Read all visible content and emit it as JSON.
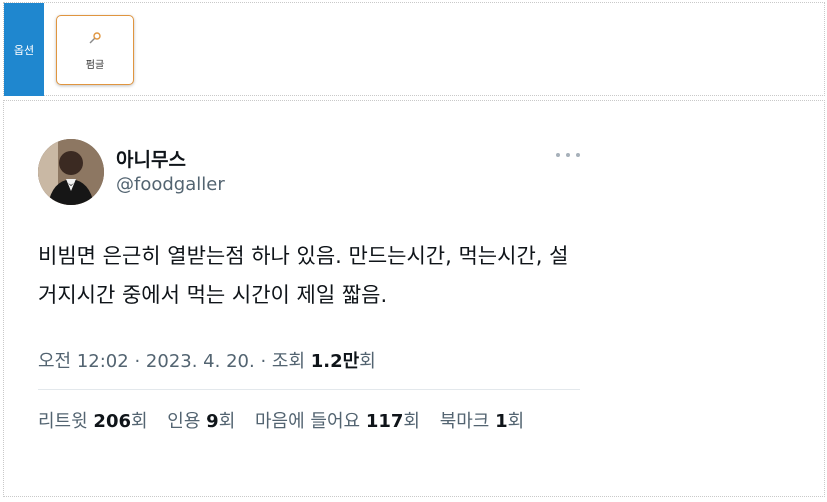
{
  "toolbar": {
    "side_tab_label": "옵션",
    "scrap_button_label": "펌글"
  },
  "tweet": {
    "display_name": "아니무스",
    "handle": "@foodgaller",
    "text": "비빔면 은근히 열받는점 하나 있음. 만드는시간, 먹는시간, 설거지시간 중에서 먹는 시간이 제일 짧음.",
    "time": "오전 12:02",
    "separator": "·",
    "date": "2023. 4. 20.",
    "views_label": "조회",
    "views_value": "1.2만",
    "views_suffix": "회",
    "stats": [
      {
        "label": "리트윗",
        "value": "206",
        "suffix": "회"
      },
      {
        "label": "인용",
        "value": "9",
        "suffix": "회"
      },
      {
        "label": "마음에 들어요",
        "value": "117",
        "suffix": "회"
      },
      {
        "label": "북마크",
        "value": "1",
        "suffix": "회"
      }
    ]
  },
  "colors": {
    "side_tab": "#1f87cf",
    "button_border": "#e0953f",
    "secondary_text": "#536471",
    "primary_text": "#0f1419"
  },
  "icons": {
    "scrap": "pin-icon",
    "more": "more-dots-icon"
  }
}
